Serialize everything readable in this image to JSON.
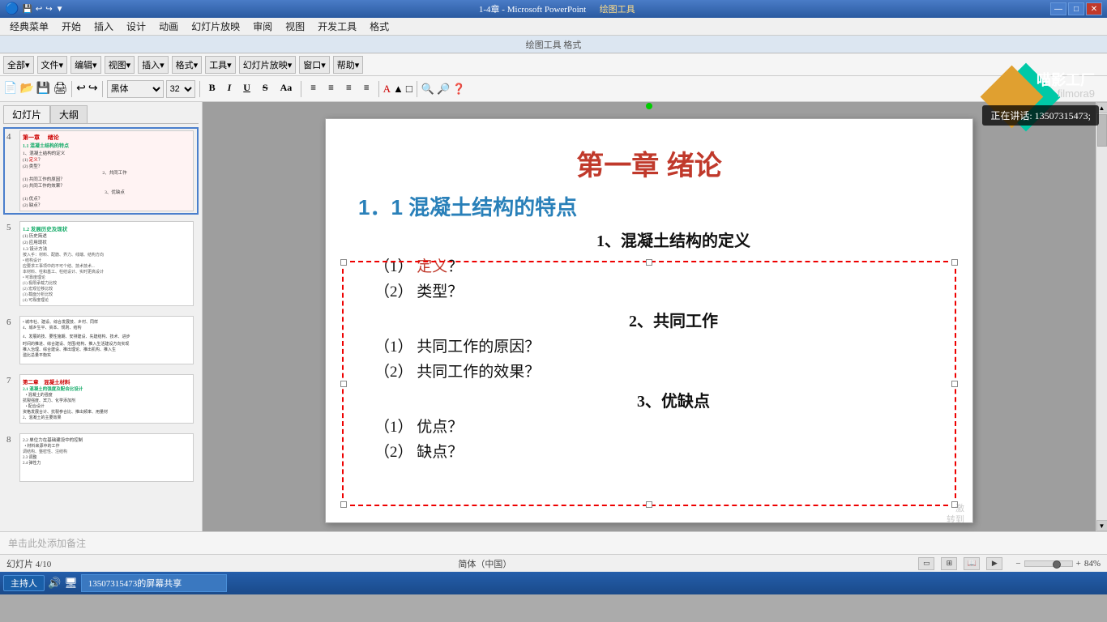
{
  "titlebar": {
    "title": "1-4章 - Microsoft PowerPoint",
    "drawing_tools": "绘图工具",
    "minimize": "—",
    "maximize": "□",
    "close": "✕"
  },
  "menubar": {
    "items": [
      "经典菜单",
      "开始",
      "插入",
      "设计",
      "动画",
      "幻灯片放映",
      "审阅",
      "视图",
      "开发工具",
      "格式"
    ]
  },
  "toolbar": {
    "font": "黑体",
    "size": "32",
    "format_buttons": [
      "B",
      "I",
      "U",
      "S",
      "Aa"
    ],
    "align_buttons": [
      "≡",
      "≡",
      "≡",
      "≡"
    ],
    "notes_placeholder": "单击此处添加备注"
  },
  "ribbon_tabs": [
    "全部▾",
    "文件▾",
    "编辑▾",
    "视图▾",
    "插入▾",
    "格式▾",
    "工具▾",
    "幻灯片放映▾",
    "窗口▾",
    "帮助▾"
  ],
  "slides_panel": {
    "tab1": "幻灯片",
    "tab2": "大纲",
    "slides": [
      {
        "num": "4",
        "active": true,
        "preview_title": "第一章    绪论",
        "preview_sub": "1.1 混凝土结构的特点",
        "preview_lines": [
          "1、混凝土结构的定义",
          "(1) 定义？",
          "(2) 类型？",
          "2、共同工作",
          "(1) 共同工作的原因？",
          "(2) 共同工作的效果？",
          "3、优缺点",
          "(1) 优点？",
          "(2) 缺点？"
        ]
      },
      {
        "num": "5",
        "active": false,
        "preview_title": "1.2 发展历史及现状",
        "preview_lines": [
          "(1) 历史简述",
          "(2) 应用现状",
          "1.3 设计方法",
          "按入手：材料、配筋、界力、线端、结构方向",
          "• 结构设计",
          "应要求工事项中的不可个结、技术技术…",
          "本材料、柱和基工、柱结设计、实时更高设计",
          "• 可靠度理论"
        ]
      },
      {
        "num": "6",
        "active": false,
        "preview_lines": [
          "城市社、建设、综合发展技、乡村、同样",
          "4、城乡生平、资本、规则、结构",
          "",
          "4、发展的技、要性施期、安排建设、先建结构、技术、进步",
          "时间的推进、综合建设、范围/结构、推入生活建设方向实现"
        ]
      },
      {
        "num": "7",
        "active": false,
        "preview_title": "第二章    混凝土材料",
        "preview_sub": "2.1 混凝土的强度及配合比设计",
        "preview_lines": [
          "• 混凝土的强度",
          "抗裂强度、宾力、化学添加剂",
          "• 配合设计",
          "资格发展合计、抗裂参合比、推出频率、用量材",
          "2、混凝土的主要效果"
        ]
      },
      {
        "num": "8",
        "active": false,
        "preview_lines": [
          "2.2 单位力在基础建设中的控制",
          "• 材料来源中的工作",
          "调结构、整密性、注结构",
          "2.3 调整",
          "2.4 弹性力"
        ]
      }
    ]
  },
  "slide_content": {
    "title": "第一章        绪论",
    "subtitle": "1．1  混凝土结构的特点",
    "section1": "1、混凝土结构的定义",
    "item1_1_label": "（1）",
    "item1_1_red": "定义",
    "item1_1_suffix": "？",
    "item1_2": "（2） 类型？",
    "section2": "2、共同工作",
    "item2_1": "（1） 共同工作的原因？",
    "item2_2": "（2） 共同工作的效果？",
    "section3": "3、优缺点",
    "item3_1": "（1） 优点？",
    "item3_2": "（2） 缺点？"
  },
  "drawing_toolbar": {
    "tabs": [
      "绘图工具"
    ]
  },
  "statusbar": {
    "left": "幻灯片 4/10",
    "middle": "简体（中国）",
    "zoom": "84%"
  },
  "notes": {
    "placeholder": "单击此处添加备注"
  },
  "taskbar": {
    "start_label": "主持人",
    "items": [
      "13507315473的屏幕共享"
    ]
  },
  "watermark": {
    "brand": "喵影工厂",
    "sub": "filmora9"
  },
  "call_overlay": {
    "text": "正在讲话: 13507315473;"
  }
}
